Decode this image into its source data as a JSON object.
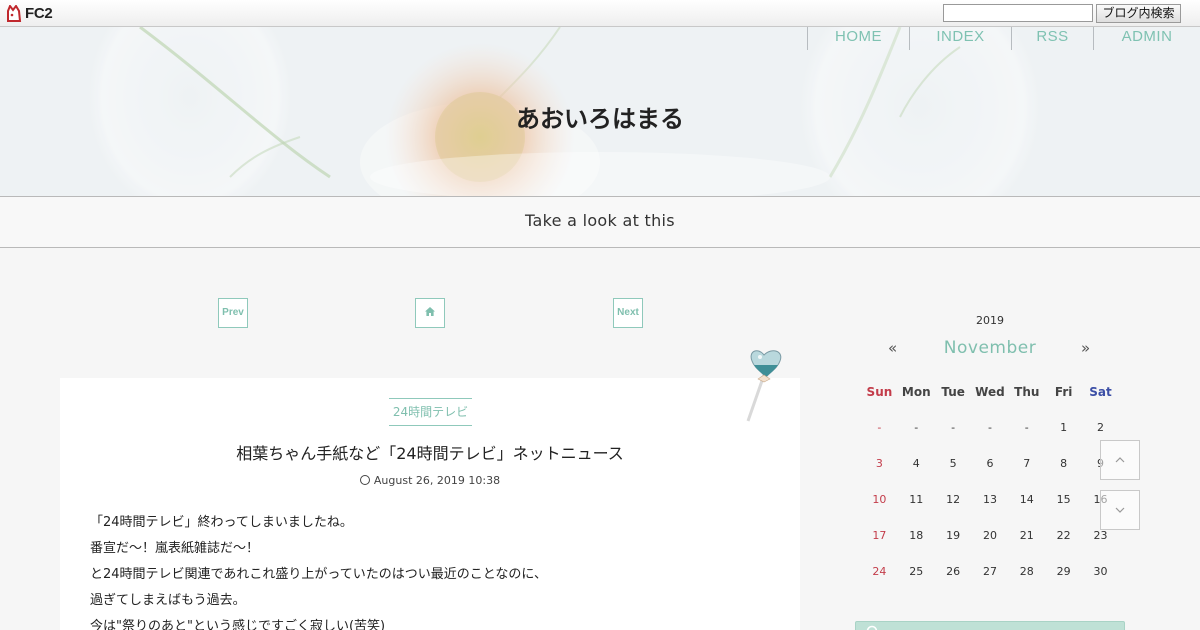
{
  "fc2bar": {
    "logo_text": "FC2",
    "search_value": "",
    "search_button": "ブログ内検索"
  },
  "header": {
    "nav": [
      "HOME",
      "INDEX",
      "RSS",
      "ADMIN"
    ],
    "title": "あおいろはまる",
    "subtitle": "Take a look at this"
  },
  "pager": {
    "prev": "Prev",
    "next": "Next"
  },
  "entry": {
    "category": "24時間テレビ",
    "title": "相葉ちゃん手紙など「24時間テレビ」ネットニュース",
    "date": "August 26, 2019 10:38",
    "body": [
      "「24時間テレビ」終わってしまいましたね。",
      "番宣だ〜！嵐表紙雑誌だ〜！",
      "と24時間テレビ関連であれこれ盛り上がっていたのはつい最近のことなのに、",
      "過ぎてしまえばもう過去。",
      "今は\"祭りのあと\"という感じですごく寂しい(苦笑)"
    ]
  },
  "calendar": {
    "year": "2019",
    "month": "November",
    "prev": "«",
    "next": "»",
    "weekdays": [
      "Sun",
      "Mon",
      "Tue",
      "Wed",
      "Thu",
      "Fri",
      "Sat"
    ],
    "weeks": [
      [
        "-",
        "-",
        "-",
        "-",
        "-",
        "1",
        "2"
      ],
      [
        "3",
        "4",
        "5",
        "6",
        "7",
        "8",
        "9"
      ],
      [
        "10",
        "11",
        "12",
        "13",
        "14",
        "15",
        "16"
      ],
      [
        "17",
        "18",
        "19",
        "20",
        "21",
        "22",
        "23"
      ],
      [
        "24",
        "25",
        "26",
        "27",
        "28",
        "29",
        "30"
      ]
    ]
  },
  "colors": {
    "accent": "#7fbfae",
    "sunday": "#c33c4a",
    "saturday": "#3c4fa6"
  }
}
